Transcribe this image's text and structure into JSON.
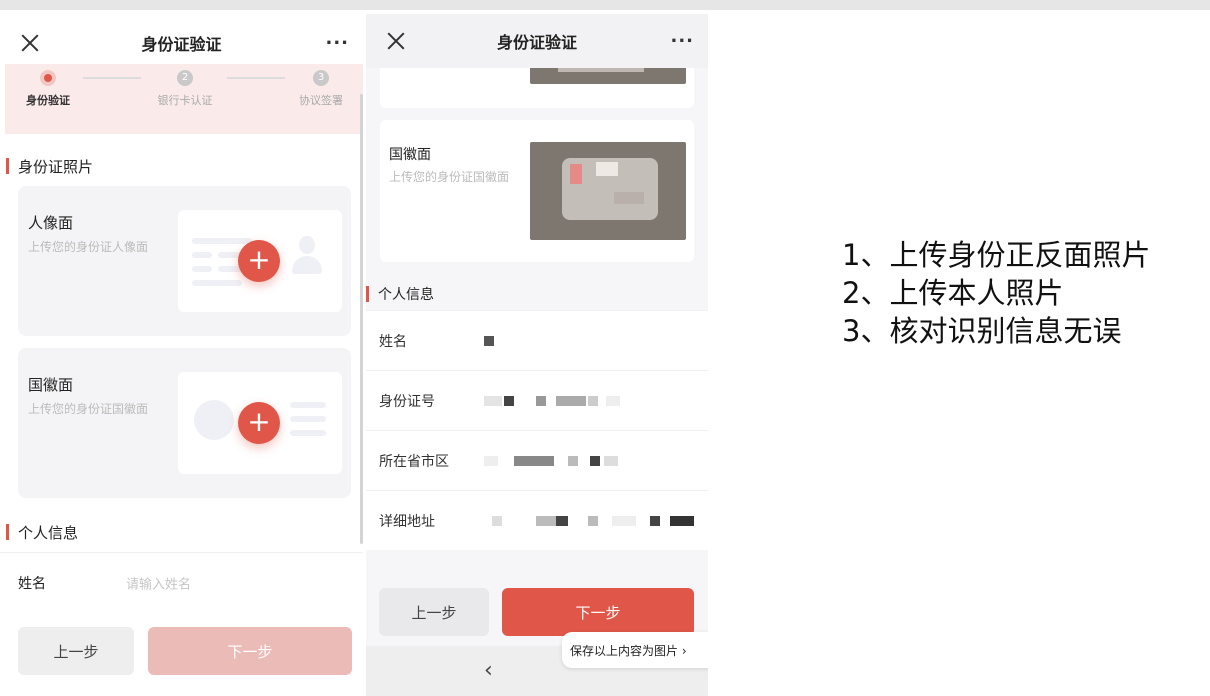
{
  "left_screen": {
    "title": "身份证验证",
    "more": "···",
    "steps": [
      {
        "number": "",
        "label": "身份验证",
        "active": true
      },
      {
        "number": "2",
        "label": "银行卡认证",
        "active": false
      },
      {
        "number": "3",
        "label": "协议签署",
        "active": false
      }
    ],
    "photos_section": "身份证照片",
    "portrait": {
      "title": "人像面",
      "hint": "上传您的身份证人像面"
    },
    "emblem": {
      "title": "国徽面",
      "hint": "上传您的身份证国徽面"
    },
    "add_glyph": "+",
    "info_section": "个人信息",
    "name_label": "姓名",
    "name_placeholder": "请输入姓名",
    "prev_label": "上一步",
    "next_label": "下一步"
  },
  "right_screen": {
    "title": "身份证验证",
    "more": "···",
    "emblem": {
      "title": "国徽面",
      "hint": "上传您的身份证国徽面"
    },
    "info_section": "个人信息",
    "fields": [
      {
        "label": "姓名"
      },
      {
        "label": "身份证号"
      },
      {
        "label": "所在省市区"
      },
      {
        "label": "详细地址"
      }
    ],
    "prev_label": "上一步",
    "next_label": "下一步",
    "save_tip": "保存以上内容为图片 ›",
    "back_arrow": "‹"
  },
  "instructions": [
    "1、上传身份正反面照片",
    "2、上传本人照片",
    "3、核对识别信息无误"
  ],
  "colors": {
    "accent": "#e0574a",
    "accent_disabled": "#ebbcb7",
    "stepper_bg": "#fbeaea"
  }
}
